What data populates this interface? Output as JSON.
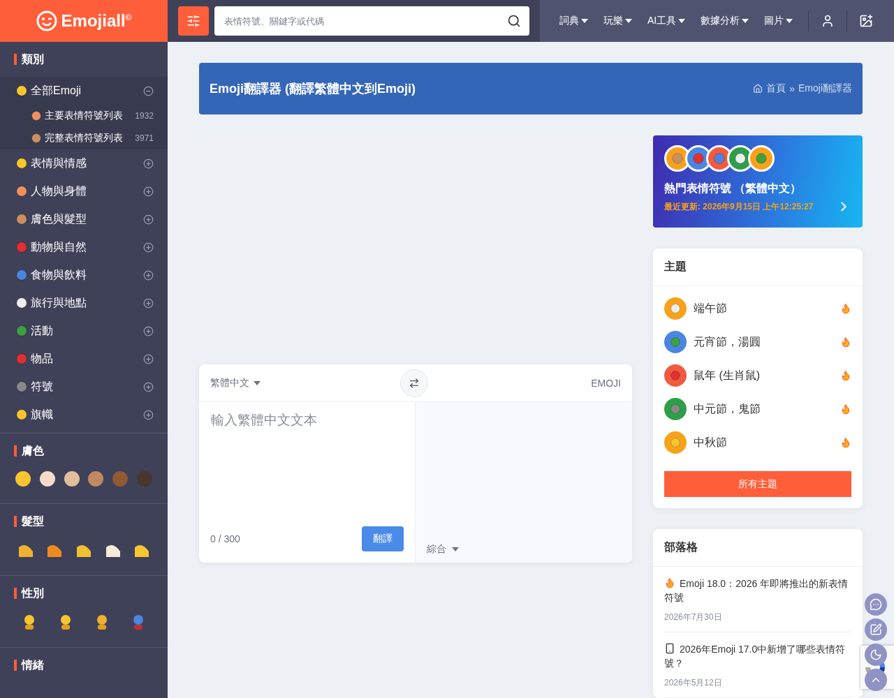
{
  "logo": {
    "text": "Emojiall",
    "mark": "©"
  },
  "search": {
    "placeholder": "表情符號、關鍵字或代碼"
  },
  "nav": [
    {
      "label": "詞典"
    },
    {
      "label": "玩樂"
    },
    {
      "label": "AI工具"
    },
    {
      "label": "數據分析"
    },
    {
      "label": "圖片"
    }
  ],
  "sidebar": {
    "title": "類別",
    "categories": [
      {
        "label": "全部Emoji",
        "expanded": true,
        "children": [
          {
            "label": "主要表情符號列表",
            "count": "1932"
          },
          {
            "label": "完整表情符號列表",
            "count": "3971"
          }
        ]
      },
      {
        "label": "表情與情感",
        "expanded": false
      },
      {
        "label": "人物與身體",
        "expanded": false
      },
      {
        "label": "膚色與髮型",
        "expanded": false
      },
      {
        "label": "動物與自然",
        "expanded": false
      },
      {
        "label": "食物與飲料",
        "expanded": false
      },
      {
        "label": "旅行與地點",
        "expanded": false
      },
      {
        "label": "活動",
        "expanded": false
      },
      {
        "label": "物品",
        "expanded": false
      },
      {
        "label": "符號",
        "expanded": false
      },
      {
        "label": "旗幟",
        "expanded": false
      }
    ],
    "sections": [
      {
        "title": "膚色",
        "kind": "skin_tones",
        "tones": [
          {
            "color": "#f6c530"
          },
          {
            "color": "#f6dcc8"
          },
          {
            "color": "#e2be9c"
          },
          {
            "color": "#bf8a62"
          },
          {
            "color": "#915a34"
          },
          {
            "color": "#4a362c"
          }
        ]
      },
      {
        "title": "髮型",
        "kind": "hair_styles"
      },
      {
        "title": "性別",
        "kind": "genders"
      },
      {
        "title": "情緒",
        "kind": "moods"
      }
    ]
  },
  "page": {
    "title": "Emoji翻譯器 (翻譯繁體中文到Emoji)",
    "breadcrumb": {
      "items": [
        "首頁",
        "Emoji翻譯器"
      ],
      "separator": "»"
    }
  },
  "translator": {
    "source_language": "繁體中文",
    "target_language": "EMOJI",
    "placeholder": "輸入繁體中文文本",
    "counter": "0 / 300",
    "button": "翻譯",
    "mode": "綜合"
  },
  "hot_card": {
    "title": "熱門表情符號 （繁體中文）",
    "updated": "最近更新: 2026年9月15日 上午12:25:27",
    "bubbles": [
      {
        "color": "#f7a21b"
      },
      {
        "color": "#4a86e0"
      },
      {
        "color": "#f05a40"
      },
      {
        "color": "#2e9e48"
      },
      {
        "color": "#f7a21b"
      }
    ]
  },
  "topics": {
    "title": "主題",
    "items": [
      {
        "label": "端午節",
        "color": "#f7a21b"
      },
      {
        "label": "元宵節，湯圓",
        "color": "#4a86e0"
      },
      {
        "label": "鼠年 (生肖鼠)",
        "color": "#f05a40"
      },
      {
        "label": "中元節，鬼節",
        "color": "#2e9e48"
      },
      {
        "label": "中秋節",
        "color": "#f7a21b"
      }
    ],
    "button": "所有主題"
  },
  "blog": {
    "title": "部落格",
    "posts": [
      {
        "kind": "fire",
        "title": "Emoji 18.0：2026 年即將推出的新表情符號",
        "date": "2026年7月30日"
      },
      {
        "kind": "phone",
        "title": "2026年Emoji 17.0中新增了哪些表情符號？",
        "date": "2026年5月12日"
      }
    ]
  }
}
